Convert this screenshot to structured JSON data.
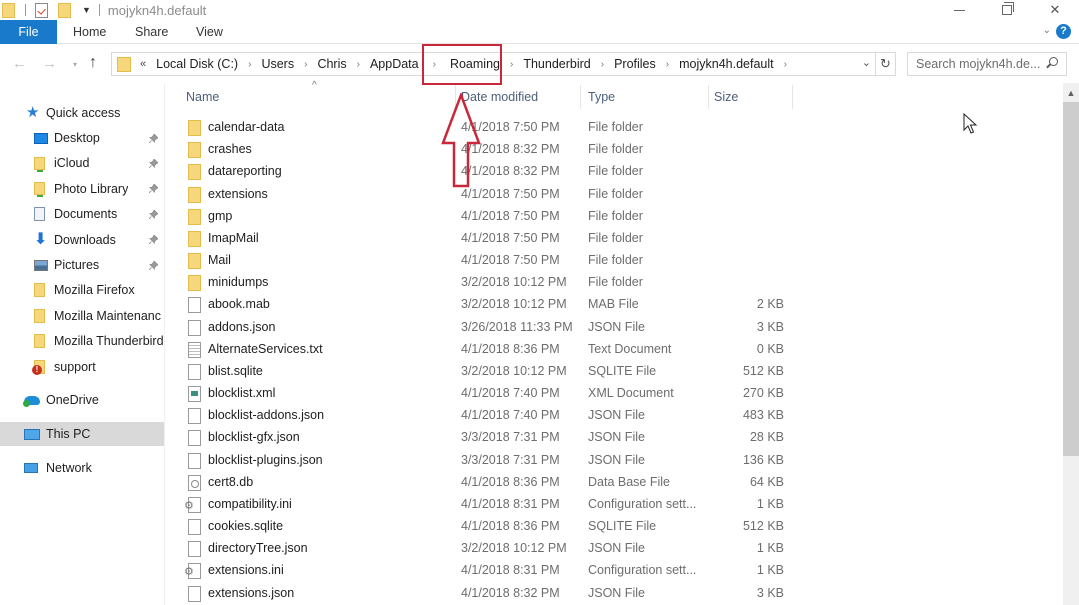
{
  "window": {
    "title": "mojykn4h.default",
    "controls": {
      "minimize": "minimize",
      "restore": "restore",
      "close": "✕"
    }
  },
  "ribbon": {
    "tabs": [
      {
        "label": "File",
        "active": true
      },
      {
        "label": "Home"
      },
      {
        "label": "Share"
      },
      {
        "label": "View"
      }
    ],
    "expand_icon": "chevron-down",
    "help_label": "?"
  },
  "navigation": {
    "back": "←",
    "forward": "→",
    "recent": "▾",
    "up": "↑",
    "overflow": "«",
    "breadcrumbs": [
      "Local Disk (C:)",
      "Users",
      "Chris",
      "AppData",
      "Roaming",
      "Thunderbird",
      "Profiles",
      "mojykn4h.default"
    ],
    "crumb_separator": "›",
    "dropdown": "⌄",
    "refresh": "↻",
    "search_placeholder": "Search mojykn4h.de..."
  },
  "sidebar": {
    "quick_access": {
      "label": "Quick access"
    },
    "pinned": [
      {
        "label": "Desktop",
        "icon": "desktop",
        "pinned": true
      },
      {
        "label": "iCloud",
        "icon": "icloud",
        "pinned": true
      },
      {
        "label": "Photo Library",
        "icon": "icloud",
        "pinned": true
      },
      {
        "label": "Documents",
        "icon": "docs",
        "pinned": true
      },
      {
        "label": "Downloads",
        "icon": "downloads",
        "pinned": true
      },
      {
        "label": "Pictures",
        "icon": "pictures",
        "pinned": true
      },
      {
        "label": "Mozilla Firefox",
        "icon": "folder",
        "pinned": false
      },
      {
        "label": "Mozilla Maintenanc",
        "icon": "folder",
        "pinned": false
      },
      {
        "label": "Mozilla Thunderbird",
        "icon": "folder",
        "pinned": false
      },
      {
        "label": "support",
        "icon": "support",
        "pinned": false
      }
    ],
    "pin_glyph": "📌",
    "onedrive": {
      "label": "OneDrive"
    },
    "this_pc": {
      "label": "This PC",
      "selected": true
    },
    "network": {
      "label": "Network"
    }
  },
  "file_list": {
    "sort_indicator": "^",
    "columns": {
      "name": "Name",
      "date": "Date modified",
      "type": "Type",
      "size": "Size"
    },
    "rows": [
      {
        "name": "calendar-data",
        "date": "4/1/2018 7:50 PM",
        "type": "File folder",
        "size": "",
        "icon": "folder"
      },
      {
        "name": "crashes",
        "date": "4/1/2018 8:32 PM",
        "type": "File folder",
        "size": "",
        "icon": "folder"
      },
      {
        "name": "datareporting",
        "date": "4/1/2018 8:32 PM",
        "type": "File folder",
        "size": "",
        "icon": "folder"
      },
      {
        "name": "extensions",
        "date": "4/1/2018 7:50 PM",
        "type": "File folder",
        "size": "",
        "icon": "folder"
      },
      {
        "name": "gmp",
        "date": "4/1/2018 7:50 PM",
        "type": "File folder",
        "size": "",
        "icon": "folder"
      },
      {
        "name": "ImapMail",
        "date": "4/1/2018 7:50 PM",
        "type": "File folder",
        "size": "",
        "icon": "folder"
      },
      {
        "name": "Mail",
        "date": "4/1/2018 7:50 PM",
        "type": "File folder",
        "size": "",
        "icon": "folder"
      },
      {
        "name": "minidumps",
        "date": "3/2/2018 10:12 PM",
        "type": "File folder",
        "size": "",
        "icon": "folder"
      },
      {
        "name": "abook.mab",
        "date": "3/2/2018 10:12 PM",
        "type": "MAB File",
        "size": "2 KB",
        "icon": "file"
      },
      {
        "name": "addons.json",
        "date": "3/26/2018 11:33 PM",
        "type": "JSON File",
        "size": "3 KB",
        "icon": "file"
      },
      {
        "name": "AlternateServices.txt",
        "date": "4/1/2018 8:36 PM",
        "type": "Text Document",
        "size": "0 KB",
        "icon": "text"
      },
      {
        "name": "blist.sqlite",
        "date": "3/2/2018 10:12 PM",
        "type": "SQLITE File",
        "size": "512 KB",
        "icon": "file"
      },
      {
        "name": "blocklist.xml",
        "date": "4/1/2018 7:40 PM",
        "type": "XML Document",
        "size": "270 KB",
        "icon": "xml"
      },
      {
        "name": "blocklist-addons.json",
        "date": "4/1/2018 7:40 PM",
        "type": "JSON File",
        "size": "483 KB",
        "icon": "file"
      },
      {
        "name": "blocklist-gfx.json",
        "date": "3/3/2018 7:31 PM",
        "type": "JSON File",
        "size": "28 KB",
        "icon": "file"
      },
      {
        "name": "blocklist-plugins.json",
        "date": "3/3/2018 7:31 PM",
        "type": "JSON File",
        "size": "136 KB",
        "icon": "file"
      },
      {
        "name": "cert8.db",
        "date": "4/1/2018 8:36 PM",
        "type": "Data Base File",
        "size": "64 KB",
        "icon": "db"
      },
      {
        "name": "compatibility.ini",
        "date": "4/1/2018 8:31 PM",
        "type": "Configuration sett...",
        "size": "1 KB",
        "icon": "config"
      },
      {
        "name": "cookies.sqlite",
        "date": "4/1/2018 8:36 PM",
        "type": "SQLITE File",
        "size": "512 KB",
        "icon": "file"
      },
      {
        "name": "directoryTree.json",
        "date": "3/2/2018 10:12 PM",
        "type": "JSON File",
        "size": "1 KB",
        "icon": "file"
      },
      {
        "name": "extensions.ini",
        "date": "4/1/2018 8:31 PM",
        "type": "Configuration sett...",
        "size": "1 KB",
        "icon": "config"
      },
      {
        "name": "extensions.json",
        "date": "4/1/2018 8:32 PM",
        "type": "JSON File",
        "size": "3 KB",
        "icon": "file"
      }
    ]
  },
  "scrollbar": {
    "up_arrow": "▲",
    "thumb_fraction": 0.68
  },
  "annotations": {
    "highlight_color": "#c8283a",
    "highlighted_crumb": "Roaming"
  },
  "colors": {
    "accent": "#1979ca",
    "selected_bg": "#d9d9d9",
    "header_text": "#4c607a",
    "secondary_text": "#6d6d6d"
  }
}
